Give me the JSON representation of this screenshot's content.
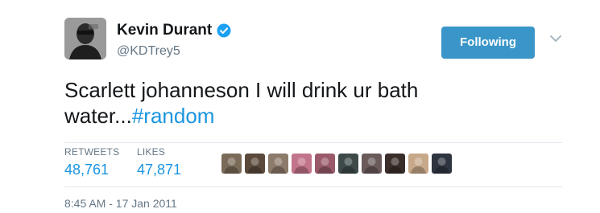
{
  "user": {
    "display_name": "Kevin Durant",
    "handle": "@KDTrey5",
    "verified_icon": "verified-badge-icon",
    "avatar_icon": "profile-avatar"
  },
  "actions": {
    "follow_label": "Following",
    "menu_icon": "chevron-down-icon"
  },
  "tweet": {
    "text_part1": "Scarlett johanneson I will drink ur bath water...",
    "hashtag": "#random"
  },
  "stats": {
    "retweets_label": "RETWEETS",
    "retweets_value": "48,761",
    "likes_label": "LIKES",
    "likes_value": "47,871"
  },
  "likers": [
    {
      "color": "#7a6a58"
    },
    {
      "color": "#5b4a3c"
    },
    {
      "color": "#8c7a6a"
    },
    {
      "color": "#c2748a"
    },
    {
      "color": "#9a5a6a"
    },
    {
      "color": "#3e4a4a"
    },
    {
      "color": "#6a5a5a"
    },
    {
      "color": "#3a2e2a"
    },
    {
      "color": "#c8a88a"
    },
    {
      "color": "#2e3440"
    }
  ],
  "timestamp": "8:45 AM - 17 Jan 2011",
  "colors": {
    "accent": "#1b95e0",
    "follow_button": "#3a96c9",
    "muted": "#657786"
  }
}
